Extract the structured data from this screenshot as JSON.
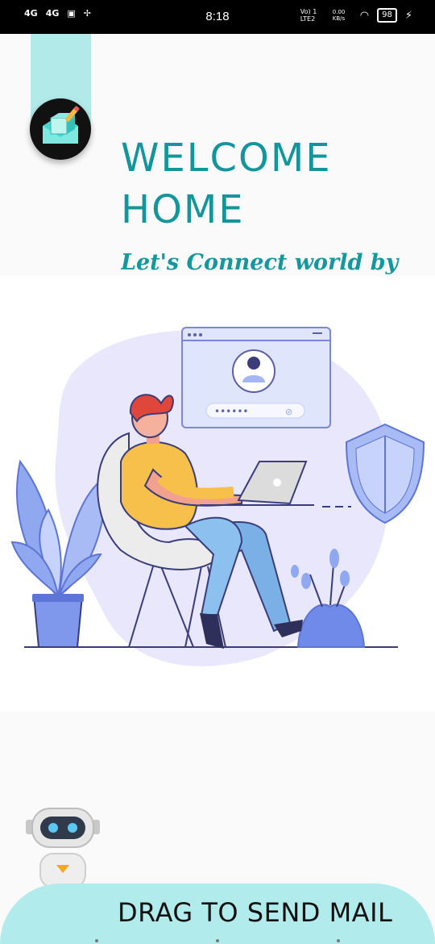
{
  "status_bar": {
    "network1": "4G",
    "network2": "4G",
    "time": "8:18",
    "lte_label": "Vo) 1 LTE2",
    "data_speed": "0.00 KB/s",
    "battery": "98"
  },
  "header": {
    "title_line1": "WELCOME",
    "title_line2": "HOME",
    "subtitle": "Let's Connect world by"
  },
  "hero": {
    "password_dots": "••••••"
  },
  "footer": {
    "drag_label": "DRAG TO SEND MAIL"
  },
  "colors": {
    "accent": "#13959b",
    "drag_bar": "#b1ebeb",
    "illustration_lavender": "#e8e7fb",
    "illustration_blue": "#8fa8f0"
  }
}
